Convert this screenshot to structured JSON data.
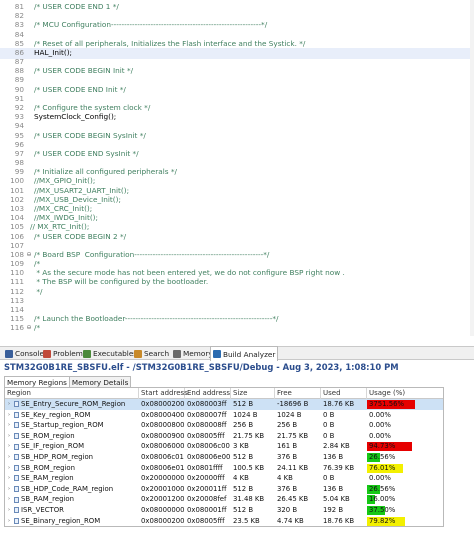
{
  "editor": {
    "lines": [
      {
        "num": "81",
        "text": "/* USER CODE END 1 */",
        "comment": true
      },
      {
        "num": "82",
        "text": "",
        "comment": false
      },
      {
        "num": "83",
        "text": "/* MCU Configuration---------------------------------------------------------*/",
        "comment": true
      },
      {
        "num": "84",
        "text": "",
        "comment": false
      },
      {
        "num": "85",
        "text": "/* Reset of all peripherals, Initializes the Flash interface and the Systick. */",
        "comment": true
      },
      {
        "num": "86",
        "text": "HAL_Init();",
        "comment": false,
        "highlight": true
      },
      {
        "num": "87",
        "text": "",
        "comment": false
      },
      {
        "num": "88",
        "text": "/* USER CODE BEGIN Init */",
        "comment": true
      },
      {
        "num": "89",
        "text": "",
        "comment": false
      },
      {
        "num": "90",
        "text": "/* USER CODE END Init */",
        "comment": true
      },
      {
        "num": "91",
        "text": "",
        "comment": false
      },
      {
        "num": "92",
        "text": "/* Configure the system clock */",
        "comment": true
      },
      {
        "num": "93",
        "text": "SystemClock_Config();",
        "comment": false
      },
      {
        "num": "94",
        "text": "",
        "comment": false
      },
      {
        "num": "95",
        "text": "/* USER CODE BEGIN SysInit */",
        "comment": true
      },
      {
        "num": "96",
        "text": "",
        "comment": false
      },
      {
        "num": "97",
        "text": "/* USER CODE END SysInit */",
        "comment": true
      },
      {
        "num": "98",
        "text": "",
        "comment": false
      },
      {
        "num": "99",
        "text": "/* Initialize all configured peripherals */",
        "comment": true
      },
      {
        "num": "100",
        "text": "//MX_GPIO_Init();",
        "comment": true
      },
      {
        "num": "101",
        "text": "//MX_USART2_UART_Init();",
        "comment": true
      },
      {
        "num": "102",
        "text": "//MX_USB_Device_Init();",
        "comment": true
      },
      {
        "num": "103",
        "text": "//MX_CRC_Init();",
        "comment": true
      },
      {
        "num": "104",
        "text": "//MX_IWDG_Init();",
        "comment": true
      },
      {
        "num": "105",
        "text": "// MX_RTC_Init();",
        "comment": true,
        "shift_left": true
      },
      {
        "num": "106",
        "text": "/* USER CODE BEGIN 2 */",
        "comment": true
      },
      {
        "num": "107",
        "text": "",
        "comment": false
      },
      {
        "num": "108",
        "text": "/* Board BSP  Configuration-------------------------------------------------*/",
        "comment": true,
        "marker": "⊖"
      },
      {
        "num": "109",
        "text": "/*",
        "comment": true
      },
      {
        "num": "110",
        "text": " * As the secure mode has not been entered yet, we do not configure BSP right now .",
        "comment": true
      },
      {
        "num": "111",
        "text": " * The BSP will be configured by the bootloader.",
        "comment": true
      },
      {
        "num": "112",
        "text": " */",
        "comment": true
      },
      {
        "num": "113",
        "text": "",
        "comment": false
      },
      {
        "num": "114",
        "text": "",
        "comment": false
      },
      {
        "num": "115",
        "text": "/* Launch the Bootloader--------------------------------------------------------*/",
        "comment": true
      },
      {
        "num": "116",
        "text": "/*",
        "comment": true,
        "marker": "⊖"
      }
    ]
  },
  "tabs": [
    {
      "label": "Console",
      "color": "#3a5f9a"
    },
    {
      "label": "Problems",
      "color": "#c04a3a"
    },
    {
      "label": "Executables",
      "color": "#4a8a3a"
    },
    {
      "label": "Search",
      "color": "#c88a2a"
    },
    {
      "label": "Memory",
      "color": "#6a6a6a"
    },
    {
      "label": "Build Analyzer",
      "color": "#2b6bb0",
      "active": true
    }
  ],
  "analyzer": {
    "title": "STM32G0B1RE_SBSFU.elf - /STM32G0B1RE_SBSFU/Debug - Aug 3, 2023, 1:08:10 PM",
    "subtabs": [
      "Memory Regions",
      "Memory Details"
    ],
    "columns": [
      "Region",
      "Start address",
      "End address",
      "Size",
      "Free",
      "Used",
      "Usage (%)"
    ],
    "rows": [
      {
        "region": "SE_Entry_Secure_ROM_Region",
        "start": "0x08000200",
        "end": "0x080003ff",
        "size": "512 B",
        "free": "-18696 B",
        "used": "18.76 KB",
        "usage": "3751.56%",
        "usage_pct": 100,
        "bar": "#e60000",
        "selected": true
      },
      {
        "region": "SE_Key_region_ROM",
        "start": "0x08000400",
        "end": "0x080007ff",
        "size": "1024 B",
        "free": "1024 B",
        "used": "0 B",
        "usage": "0.00%",
        "usage_pct": 0,
        "bar": ""
      },
      {
        "region": "SE_Startup_region_ROM",
        "start": "0x08000800",
        "end": "0x080008ff",
        "size": "256 B",
        "free": "256 B",
        "used": "0 B",
        "usage": "0.00%",
        "usage_pct": 0,
        "bar": ""
      },
      {
        "region": "SE_ROM_region",
        "start": "0x08000900",
        "end": "0x08005fff",
        "size": "21.75 KB",
        "free": "21.75 KB",
        "used": "0 B",
        "usage": "0.00%",
        "usage_pct": 0,
        "bar": ""
      },
      {
        "region": "SE_IF_region_ROM",
        "start": "0x08006000",
        "end": "0x08006c00",
        "size": "3 KB",
        "free": "161 B",
        "used": "2.84 KB",
        "usage": "94.73%",
        "usage_pct": 94.73,
        "bar": "#e60000"
      },
      {
        "region": "SB_HDP_ROM_region",
        "start": "0x08006c01",
        "end": "0x08006e00",
        "size": "512 B",
        "free": "376 B",
        "used": "136 B",
        "usage": "26.56%",
        "usage_pct": 26.56,
        "bar": "#16c816"
      },
      {
        "region": "SB_ROM_region",
        "start": "0x08006e01",
        "end": "0x0801ffff",
        "size": "100.5 KB",
        "free": "24.11 KB",
        "used": "76.39 KB",
        "usage": "76.01%",
        "usage_pct": 76.01,
        "bar": "#f3f000"
      },
      {
        "region": "SE_RAM_region",
        "start": "0x20000000",
        "end": "0x20000fff",
        "size": "4 KB",
        "free": "4 KB",
        "used": "0 B",
        "usage": "0.00%",
        "usage_pct": 0,
        "bar": ""
      },
      {
        "region": "SB_HDP_Code_RAM_region",
        "start": "0x20001000",
        "end": "0x200011ff",
        "size": "512 B",
        "free": "376 B",
        "used": "136 B",
        "usage": "26.56%",
        "usage_pct": 26.56,
        "bar": "#16c816"
      },
      {
        "region": "SB_RAM_region",
        "start": "0x20001200",
        "end": "0x20008fef",
        "size": "31.48 KB",
        "free": "26.45 KB",
        "used": "5.04 KB",
        "usage": "16.00%",
        "usage_pct": 16,
        "bar": "#16c816"
      },
      {
        "region": "ISR_VECTOR",
        "start": "0x08000000",
        "end": "0x080001ff",
        "size": "512 B",
        "free": "320 B",
        "used": "192 B",
        "usage": "37.50%",
        "usage_pct": 37.5,
        "bar": "#16c816"
      },
      {
        "region": "SE_Binary_region_ROM",
        "start": "0x08000200",
        "end": "0x08005fff",
        "size": "23.5 KB",
        "free": "4.74 KB",
        "used": "18.76 KB",
        "usage": "79.82%",
        "usage_pct": 79.82,
        "bar": "#f3f000"
      }
    ]
  }
}
